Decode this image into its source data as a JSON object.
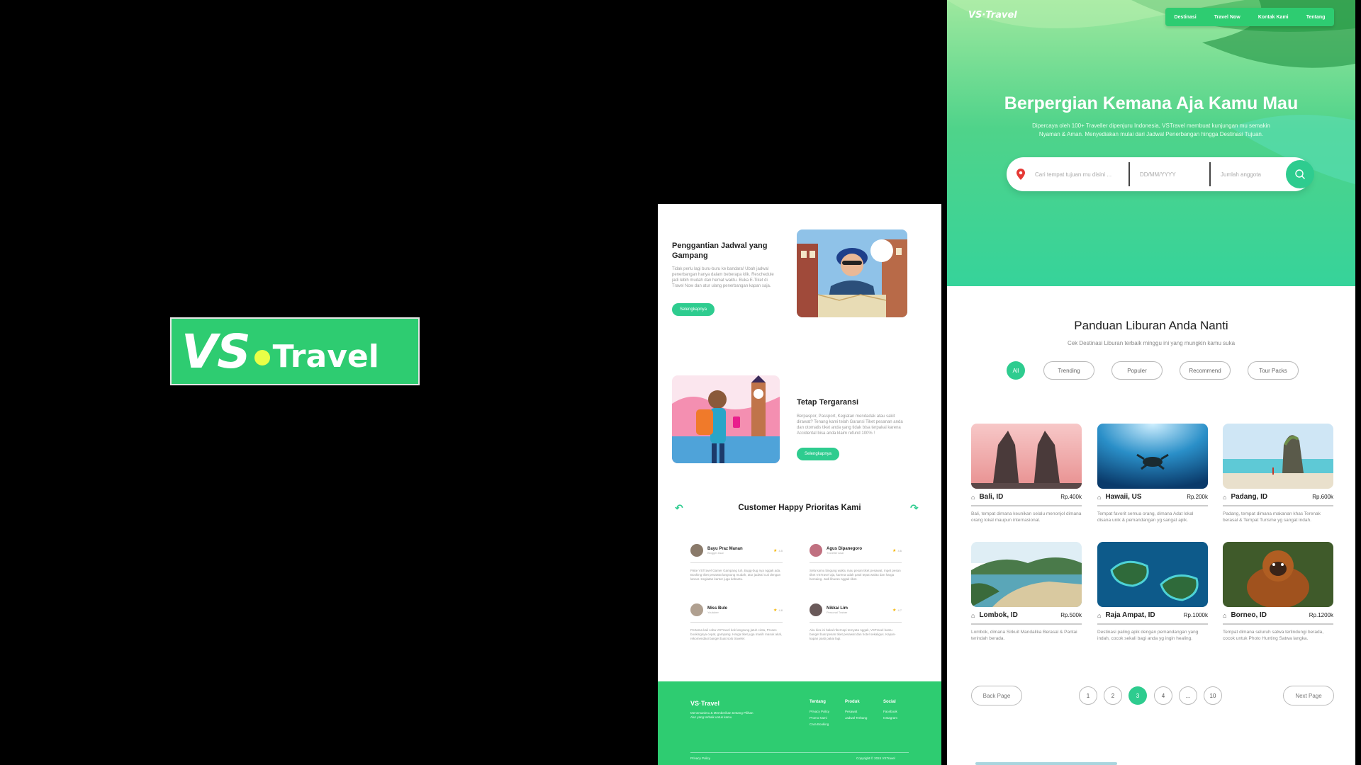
{
  "logo": {
    "vs": "VS",
    "word": "Travel"
  },
  "middle": {
    "feature1": {
      "title": "Penggantian Jadwal yang Gampang",
      "desc": "Tidak perlu lagi buru-buru ke bandara! Ubah jadwal penerbangan hanya dalam beberapa klik. Reschedule jadi lebih mudah dan hemat waktu. Buka E-Tiket di Travel Now dan atur ulang penerbangan kapan saja.",
      "button": "Selengkapnya"
    },
    "feature2": {
      "title": "Tetap Tergaransi",
      "desc": "Berpaspor, Passport, Kegiatan mendadak atau sakit dirawat? Tenang kami telah Garansi Tiket pesanan anda dan otomatis tiket anda yang tidak bisa terpakai karena Accidental bisa anda klaim refund 100% !",
      "button": "Selengkapnya"
    },
    "reviews_title": "Customer Happy Prioritas Kami",
    "reviews": [
      {
        "name": "Bayu Praz Manan",
        "role": "Blogger Asal",
        "rating": "4.5",
        "text": "Pake VSTravel Gamer Gampang tuh, Bugg-bug nya nggak ada. Booking tiket pesawat langsung mudah, atur jadwal cuti dengan lancar. Kegiatan kantor juga kebantu."
      },
      {
        "name": "Agus Dipanegoro",
        "role": "Traveller Asal",
        "rating": "4.6",
        "text": "Sela kamu bingung waktu mau pesan tiket pesawat, Inget pesan tiket VSTravel aja, karena udah pasti tepat waktu dan harga bersaing. Jadi liburan nggak ribet."
      },
      {
        "name": "Miss Bule",
        "role": "Youtuber",
        "rating": "4.8",
        "text": "Pertama kali coba VSTravel kok langsung jatuh cinta, Proses bookingnya cepat, gampang. Harga tiket juga masih masuk akal, rekomendasi banget buat solo traveler."
      },
      {
        "name": "Nikkai Lim",
        "role": "Personal Trainer",
        "rating": "4.7",
        "text": "Aku kira ini bakal ribet tapi ternyata nggak, VSTravel bantu banget buat pesan tiket pesawat dan hotel sekaligus. Kapan-kapan pasti pakai lagi."
      }
    ],
    "footer": {
      "brand": "VS·Travel",
      "tagline": "Menemanimu & Memberikan tentang Pilihan Alur yang terbaik untuk kamu",
      "cols": [
        {
          "head": "Tentang",
          "items": [
            "Privacy Policy",
            "Promo Kami",
            "Cara Booking"
          ]
        },
        {
          "head": "Produk",
          "items": [
            "Pesawat",
            "Jadwal Terbang"
          ]
        },
        {
          "head": "Social",
          "items": [
            "Facebook",
            "Instagram"
          ]
        }
      ],
      "bottom_left": "Privacy Policy",
      "bottom_right": "Copyright © 2024 VSTravel"
    }
  },
  "right": {
    "nav_brand": "VS·Travel",
    "nav": [
      "Destinasi",
      "Travel Now",
      "Kontak Kami",
      "Tentang"
    ],
    "hero_title": "Berpergian Kemana Aja Kamu Mau",
    "hero_sub_1": "Dipercaya oleh 100+ Traveller dipenjuru Indonesia, VSTravel membuat kunjungan mu semakin",
    "hero_sub_2": "Nyaman & Aman. Menyediakan mulai dari Jadwal Penerbangan hingga Destinasi Tujuan.",
    "search": {
      "place": "Cari tempat tujuan mu disini ...",
      "date": "DD/MM/YYYY",
      "people": "Jumlah anggota"
    },
    "section_title": "Panduan Liburan Anda Nanti",
    "section_sub": "Cek Destinasi Liburan terbaik minggu ini yang mungkin kamu suka",
    "filters": [
      "All",
      "Trending",
      "Populer",
      "Recommend",
      "Tour Packs"
    ],
    "cards": [
      {
        "name": "Bali, ID",
        "price": "Rp.400k",
        "desc": "Bali, tempat dimana keunikan selalu menonjol dimana orang lokal maupun internasional."
      },
      {
        "name": "Hawaii, US",
        "price": "Rp.200k",
        "desc": "Tempat favorit semua orang, dimana Adat lokal disana unik & pemandangan yg sangat apik."
      },
      {
        "name": "Padang, ID",
        "price": "Rp.600k",
        "desc": "Padang, tempat dimana makanan khas Terenak berasal & Tempat Turisme yg sangat indah."
      },
      {
        "name": "Lombok, ID",
        "price": "Rp.500k",
        "desc": "Lombok, dimana Sirkuit Mandalika Berasal & Pantai terindah berada."
      },
      {
        "name": "Raja Ampat, ID",
        "price": "Rp.1000k",
        "desc": "Destinasi paling apik dengan pemandangan yang indah, cocok sekali bagi anda yg ingin healing."
      },
      {
        "name": "Borneo, ID",
        "price": "Rp.1200k",
        "desc": "Tempat dimana seluruh satwa terlindungi berada, cocok untuk Photo Hunting Satwa langka."
      }
    ],
    "pagination": {
      "back": "Back Page",
      "next": "Next Page",
      "pages": [
        "1",
        "2",
        "3",
        "4",
        "...",
        "10"
      ],
      "active": "3"
    }
  },
  "colors": {
    "green": "#2ecc71",
    "accent": "#2ecc8f"
  }
}
